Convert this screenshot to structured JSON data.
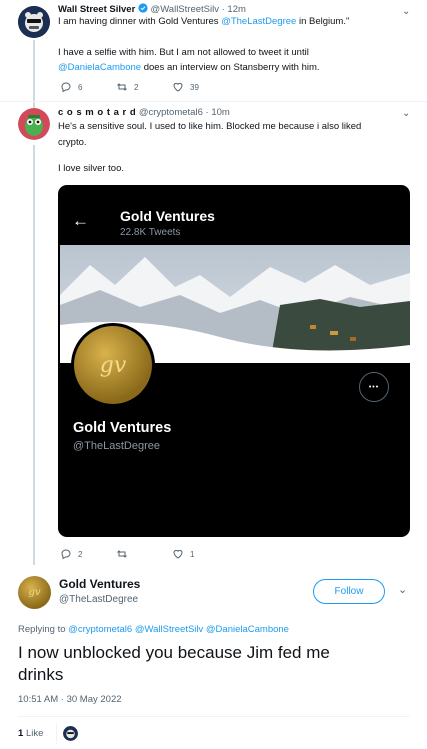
{
  "tweet1": {
    "name": "Wall Street Silver",
    "handle": "@WallStreetSilv",
    "time": "12m",
    "line1_pre": "I am having dinner with Gold Ventures ",
    "line1_mention": "@TheLastDegree",
    "line1_post": " in Belgium.\"",
    "line2": "I have a selfie with him. But I am not allowed to tweet it until",
    "line3_mention": "@DanielaCambone",
    "line3_post": " does an interview on Stansberry with him.",
    "replies": "6",
    "retweets": "2",
    "likes": "39"
  },
  "tweet2": {
    "name": "c o s m o t a r d",
    "handle": "@cryptometal6",
    "time": "10m",
    "line1": "He's a sensitive soul. I used to like him. Blocked me because i also liked",
    "line2": "crypto.",
    "line3": "I love silver too.",
    "replies": "2",
    "retweets": "",
    "likes": "1"
  },
  "card": {
    "back_arrow": "←",
    "title": "Gold Ventures",
    "tweets_count": "22.8K Tweets",
    "avatar_text": "gv",
    "profile_name": "Gold Ventures",
    "profile_handle": "@TheLastDegree",
    "more": "•••"
  },
  "main": {
    "name": "Gold Ventures",
    "handle": "@TheLastDegree",
    "follow_label": "Follow",
    "avatar_text": "gv",
    "replying_label": "Replying to ",
    "replying_to_1": "@cryptometal6",
    "replying_to_2": "@WallStreetSilv",
    "replying_to_3": "@DanielaCambone",
    "text_line1": "I now unblocked you because Jim fed me",
    "text_line2": "drinks",
    "timestamp": "10:51 AM · 30 May 2022",
    "likes_count": "1",
    "likes_label": "Like"
  },
  "colors": {
    "accent": "#1d9bf0",
    "text": "#0f1419",
    "muted": "#536471",
    "border": "#cfd9de",
    "card_bg": "#000000"
  }
}
